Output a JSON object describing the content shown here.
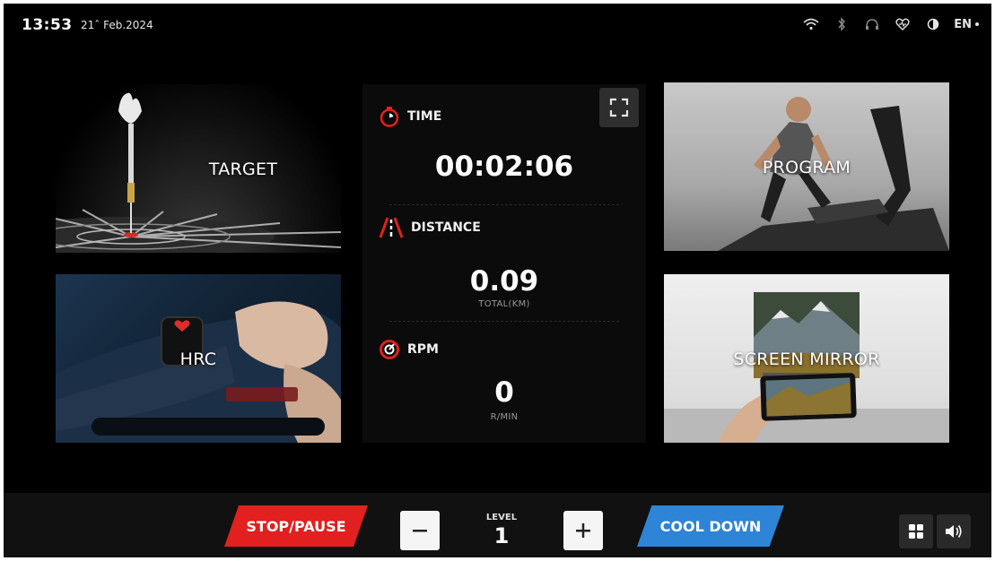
{
  "status": {
    "time": "13:53",
    "date": "21ˆ Feb.2024",
    "icons": [
      "wifi-icon",
      "bluetooth-icon",
      "headphones-icon",
      "heart-rate-icon",
      "contrast-icon"
    ],
    "language": "EN"
  },
  "tiles": {
    "target": "TARGET",
    "hrc": "HRC",
    "program": "PROGRAM",
    "screen_mirror": "SCREEN MIRROR"
  },
  "metrics": {
    "time": {
      "label": "TIME",
      "value": "00:02:06"
    },
    "distance": {
      "label": "DISTANCE",
      "value": "0.09",
      "unit": "TOTAL(KM)"
    },
    "rpm": {
      "label": "RPM",
      "value": "0",
      "unit": "R/MIN"
    }
  },
  "controls": {
    "stop_pause": "STOP/PAUSE",
    "level_label": "LEVEL",
    "level_value": "1",
    "cool_down": "COOL DOWN"
  },
  "colors": {
    "accent_red": "#e1201f",
    "accent_blue": "#2e84d6",
    "background": "#000000"
  }
}
